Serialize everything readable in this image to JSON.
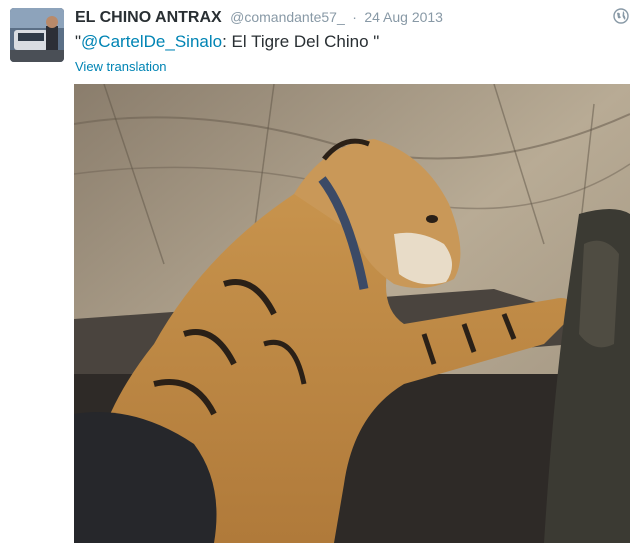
{
  "tweet": {
    "author_name": "EL CHINO ANTRAX",
    "handle": "@comandante57_",
    "separator": "·",
    "date": "24 Aug 2013",
    "text_open_quote": "\"",
    "mention": "@CartelDe_Sinalo",
    "text_rest": ": El Tigre Del Chino \"",
    "translation_link": "View translation"
  },
  "icons": {
    "globe": "globe-icon"
  }
}
